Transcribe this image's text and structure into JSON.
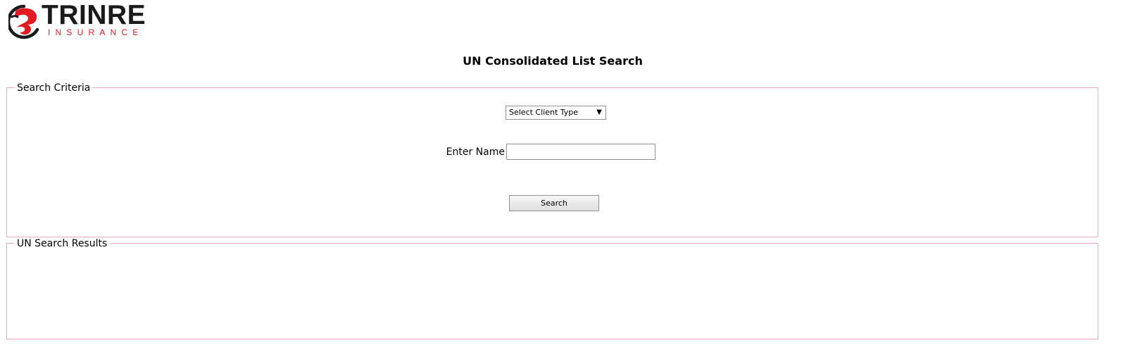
{
  "logo": {
    "wordmark": "TRINRE",
    "tagline": "INSURANCE",
    "brand_red": "#e11b22",
    "brand_dark": "#1a1a1a",
    "icon": "trinre-logo-icon"
  },
  "page": {
    "title": "UN Consolidated List Search"
  },
  "criteria": {
    "legend": "Search Criteria",
    "client_type": {
      "selected": "Select Client Type",
      "icon": "chevron-down-icon"
    },
    "name": {
      "label": "Enter Name",
      "value": "",
      "placeholder": ""
    },
    "search_label": "Search"
  },
  "results": {
    "legend": "UN Search Results"
  },
  "colors": {
    "fieldset_border": "#f2a7bb"
  }
}
